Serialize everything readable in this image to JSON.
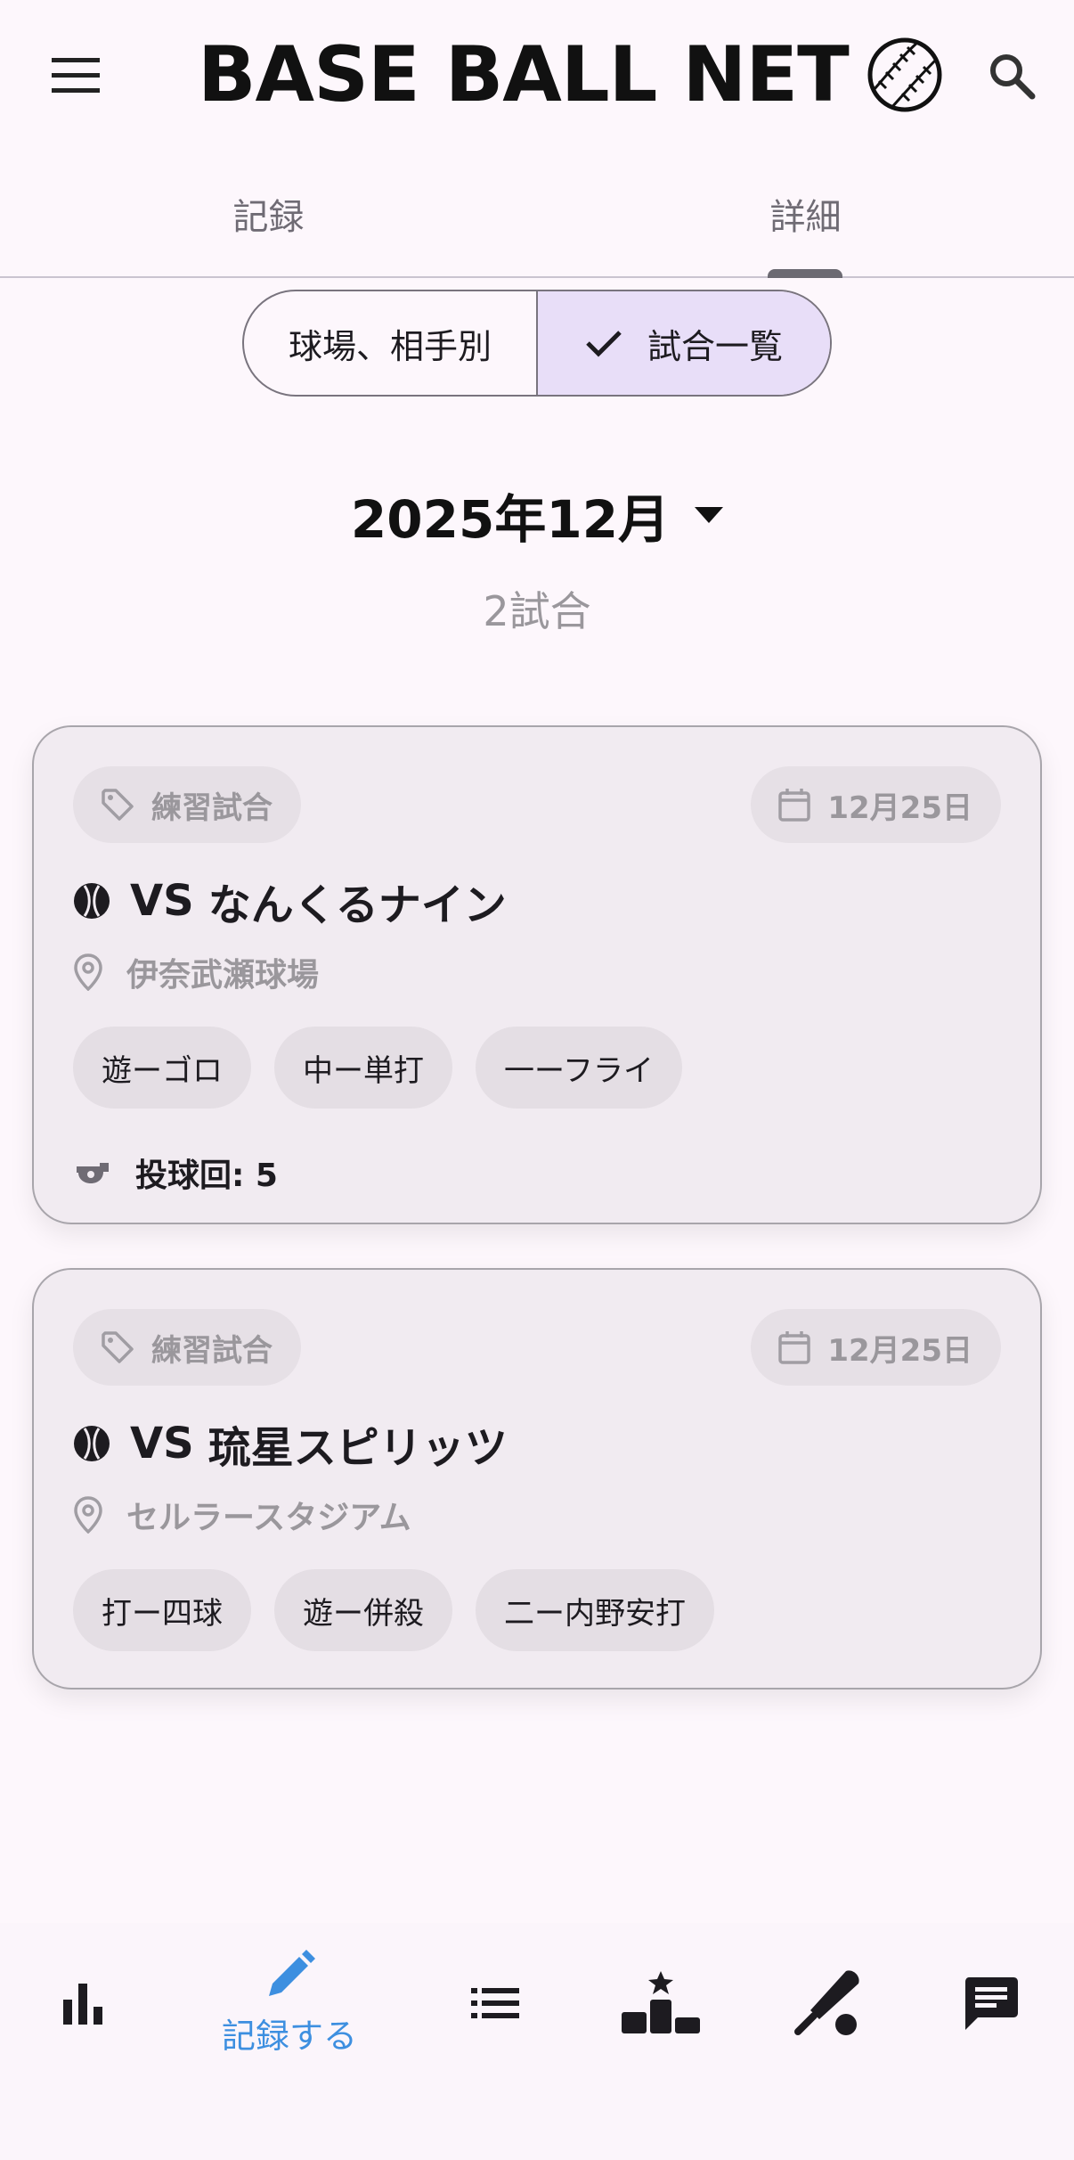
{
  "header": {
    "title": "BASE BALL NET"
  },
  "tabs": [
    {
      "label": "記録"
    },
    {
      "label": "詳細"
    }
  ],
  "segmented": {
    "options": [
      "球場、相手別",
      "試合一覧"
    ],
    "selected_index": 1
  },
  "month_selector": {
    "label": "2025年12月"
  },
  "game_count": "2試合",
  "games": [
    {
      "type": "練習試合",
      "date": "12月25日",
      "vs": "VS",
      "opponent": "なんくるナイン",
      "stadium": "伊奈武瀬球場",
      "results": [
        "遊ーゴロ",
        "中ー単打",
        "一ーフライ"
      ],
      "innings_label": "投球回: 5"
    },
    {
      "type": "練習試合",
      "date": "12月25日",
      "vs": "VS",
      "opponent": "琉星スピリッツ",
      "stadium": "セルラースタジアム",
      "results": [
        "打ー四球",
        "遊ー併殺",
        "二ー内野安打"
      ]
    }
  ],
  "bottom_nav": {
    "items": [
      {
        "icon": "bar-chart-icon"
      },
      {
        "icon": "pencil-icon",
        "label": "記録する",
        "active": true
      },
      {
        "icon": "list-icon"
      },
      {
        "icon": "podium-icon"
      },
      {
        "icon": "bat-icon"
      },
      {
        "icon": "chat-icon"
      }
    ]
  },
  "colors": {
    "background": "#fdf7fc",
    "accent_blue": "#3d8fe0",
    "segment_selected": "#e8def8",
    "card_bg": "#f1ebf1"
  }
}
